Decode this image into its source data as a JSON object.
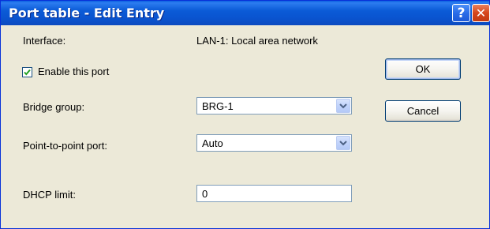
{
  "window": {
    "title": "Port table - Edit Entry"
  },
  "titlebar_buttons": {
    "help_label": "?",
    "close_label": "✕"
  },
  "form": {
    "interface_label": "Interface:",
    "interface_value": "LAN-1: Local area network",
    "enable_port_label": "Enable this port",
    "enable_port_checked": true,
    "bridge_group_label": "Bridge group:",
    "bridge_group_value": "BRG-1",
    "point_to_point_label": "Point-to-point port:",
    "point_to_point_value": "Auto",
    "dhcp_limit_label": "DHCP limit:",
    "dhcp_limit_value": "0"
  },
  "buttons": {
    "ok_label": "OK",
    "cancel_label": "Cancel"
  },
  "icons": {
    "help": "help-icon",
    "close": "close-icon",
    "checkmark": "checkmark-icon",
    "dropdown": "chevron-down-icon"
  }
}
